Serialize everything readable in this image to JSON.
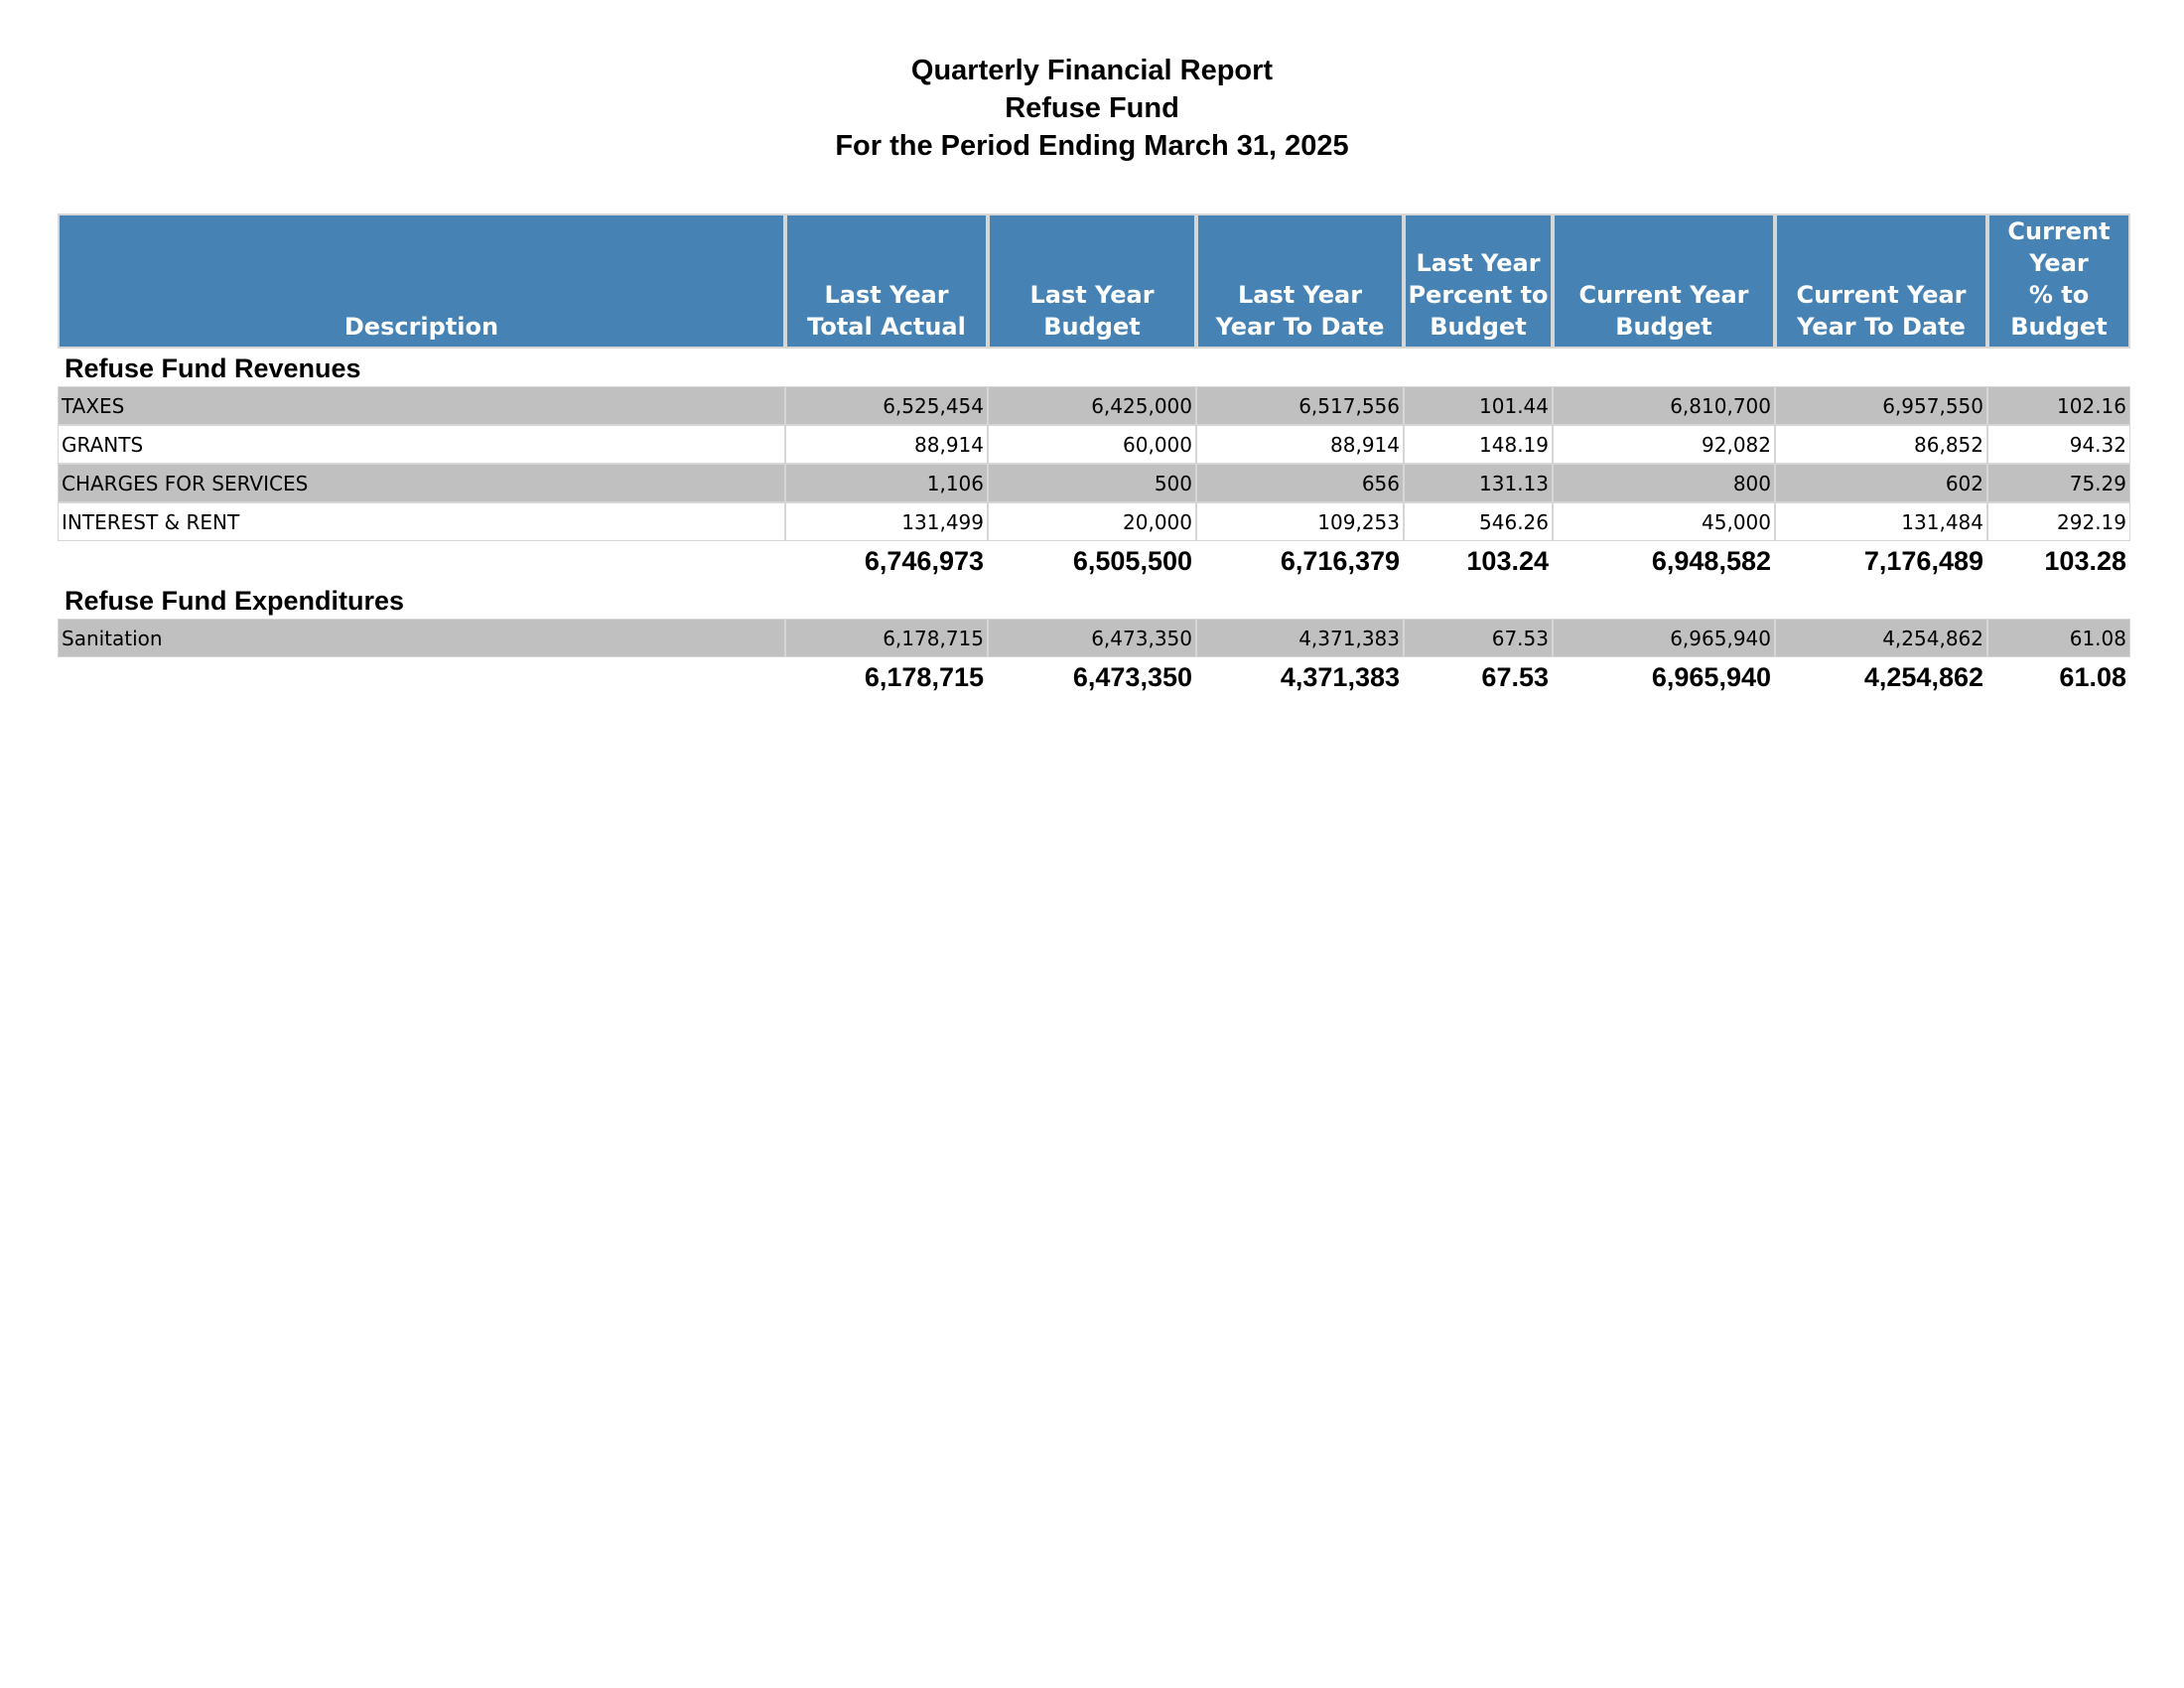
{
  "report": {
    "title": "Quarterly Financial Report",
    "fund": "Refuse Fund",
    "period": "For the Period Ending March 31, 2025"
  },
  "columns": {
    "description": "Description",
    "ly_total_actual": [
      "Last Year",
      "Total Actual"
    ],
    "ly_budget": [
      "Last Year",
      "Budget"
    ],
    "ly_ytd": [
      "Last Year",
      "Year To Date"
    ],
    "ly_pct": [
      "Last Year",
      "Percent to",
      "Budget"
    ],
    "cy_budget": [
      "Current Year",
      "Budget"
    ],
    "cy_ytd": [
      "Current Year",
      "Year To Date"
    ],
    "cy_pct": [
      "Current",
      "Year",
      "% to",
      "Budget"
    ]
  },
  "revenues": {
    "heading": "Refuse Fund Revenues",
    "rows": [
      {
        "label": "TAXES",
        "v": [
          "6,525,454",
          "6,425,000",
          "6,517,556",
          "101.44",
          "6,810,700",
          "6,957,550",
          "102.16"
        ]
      },
      {
        "label": "GRANTS",
        "v": [
          "88,914",
          "60,000",
          "88,914",
          "148.19",
          "92,082",
          "86,852",
          "94.32"
        ]
      },
      {
        "label": "CHARGES FOR SERVICES",
        "v": [
          "1,106",
          "500",
          "656",
          "131.13",
          "800",
          "602",
          "75.29"
        ]
      },
      {
        "label": "INTEREST & RENT",
        "v": [
          "131,499",
          "20,000",
          "109,253",
          "546.26",
          "45,000",
          "131,484",
          "292.19"
        ]
      }
    ],
    "total": [
      "6,746,973",
      "6,505,500",
      "6,716,379",
      "103.24",
      "6,948,582",
      "7,176,489",
      "103.28"
    ]
  },
  "expenditures": {
    "heading": "Refuse Fund Expenditures",
    "rows": [
      {
        "label": "Sanitation",
        "v": [
          "6,178,715",
          "6,473,350",
          "4,371,383",
          "67.53",
          "6,965,940",
          "4,254,862",
          "61.08"
        ]
      }
    ],
    "total": [
      "6,178,715",
      "6,473,350",
      "4,371,383",
      "67.53",
      "6,965,940",
      "4,254,862",
      "61.08"
    ]
  }
}
